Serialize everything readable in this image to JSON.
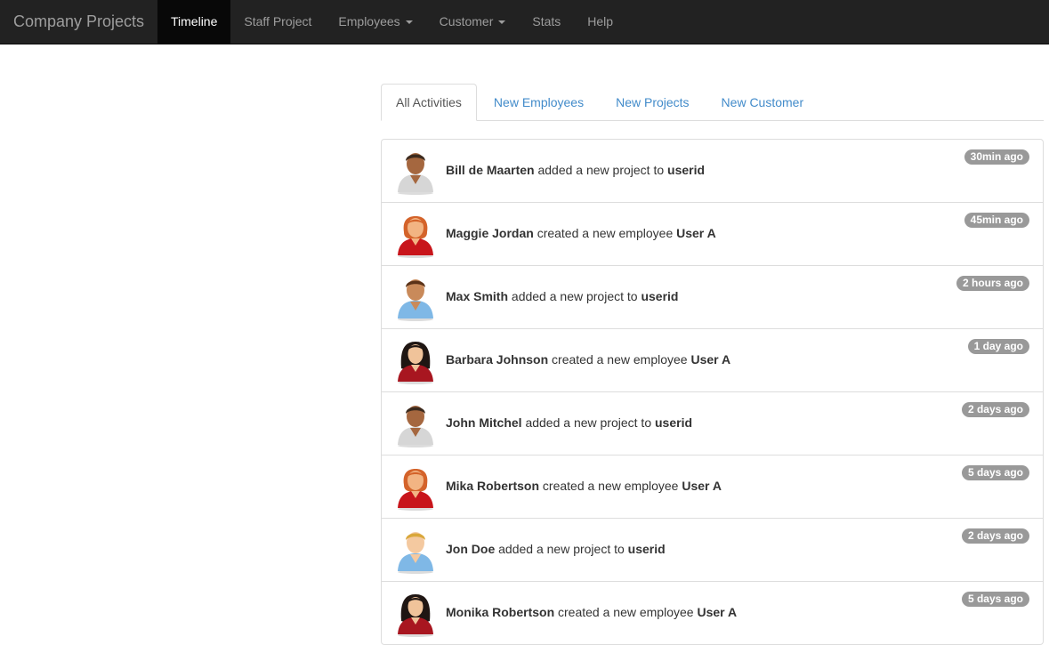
{
  "navbar": {
    "brand": "Company Projects",
    "links": [
      {
        "label": "Timeline",
        "active": true,
        "dropdown": false
      },
      {
        "label": "Staff Project",
        "active": false,
        "dropdown": false
      },
      {
        "label": "Employees",
        "active": false,
        "dropdown": true
      },
      {
        "label": "Customer",
        "active": false,
        "dropdown": true
      },
      {
        "label": "Stats",
        "active": false,
        "dropdown": false
      },
      {
        "label": "Help",
        "active": false,
        "dropdown": false
      }
    ]
  },
  "tabs": [
    {
      "label": "All Activities",
      "active": true
    },
    {
      "label": "New Employees",
      "active": false
    },
    {
      "label": "New Projects",
      "active": false
    },
    {
      "label": "New Customer",
      "active": false
    }
  ],
  "activities": [
    {
      "name": "Bill de Maarten",
      "action": "added a new project to",
      "target": "userid",
      "time": "30min ago",
      "avatar": "male-dark-grey-shirt-icon"
    },
    {
      "name": "Maggie Jordan",
      "action": "created a new employee",
      "target": "User A",
      "time": "45min ago",
      "avatar": "female-redhead-red-shirt-icon"
    },
    {
      "name": "Max Smith",
      "action": "added a new project to",
      "target": "userid",
      "time": "2 hours ago",
      "avatar": "male-brown-blue-shirt-icon"
    },
    {
      "name": "Barbara Johnson",
      "action": "created a new employee",
      "target": "User A",
      "time": "1 day ago",
      "avatar": "female-black-hair-red-shirt-icon"
    },
    {
      "name": "John Mitchel",
      "action": "added a new project to",
      "target": "userid",
      "time": "2 days ago",
      "avatar": "male-dark-grey-shirt-icon"
    },
    {
      "name": "Mika Robertson",
      "action": "created a new employee",
      "target": "User A",
      "time": "5 days ago",
      "avatar": "female-redhead-red-shirt-icon"
    },
    {
      "name": "Jon Doe",
      "action": "added a new project to",
      "target": "userid",
      "time": "2 days ago",
      "avatar": "male-blond-blue-shirt-icon"
    },
    {
      "name": "Monika Robertson",
      "action": "created a new employee",
      "target": "User A",
      "time": "5 days ago",
      "avatar": "female-black-hair-red-shirt-icon"
    }
  ],
  "colors": {
    "navbar_bg": "#222222",
    "navbar_active_bg": "#080808",
    "link_blue": "#428bca",
    "badge_grey": "#999999"
  }
}
